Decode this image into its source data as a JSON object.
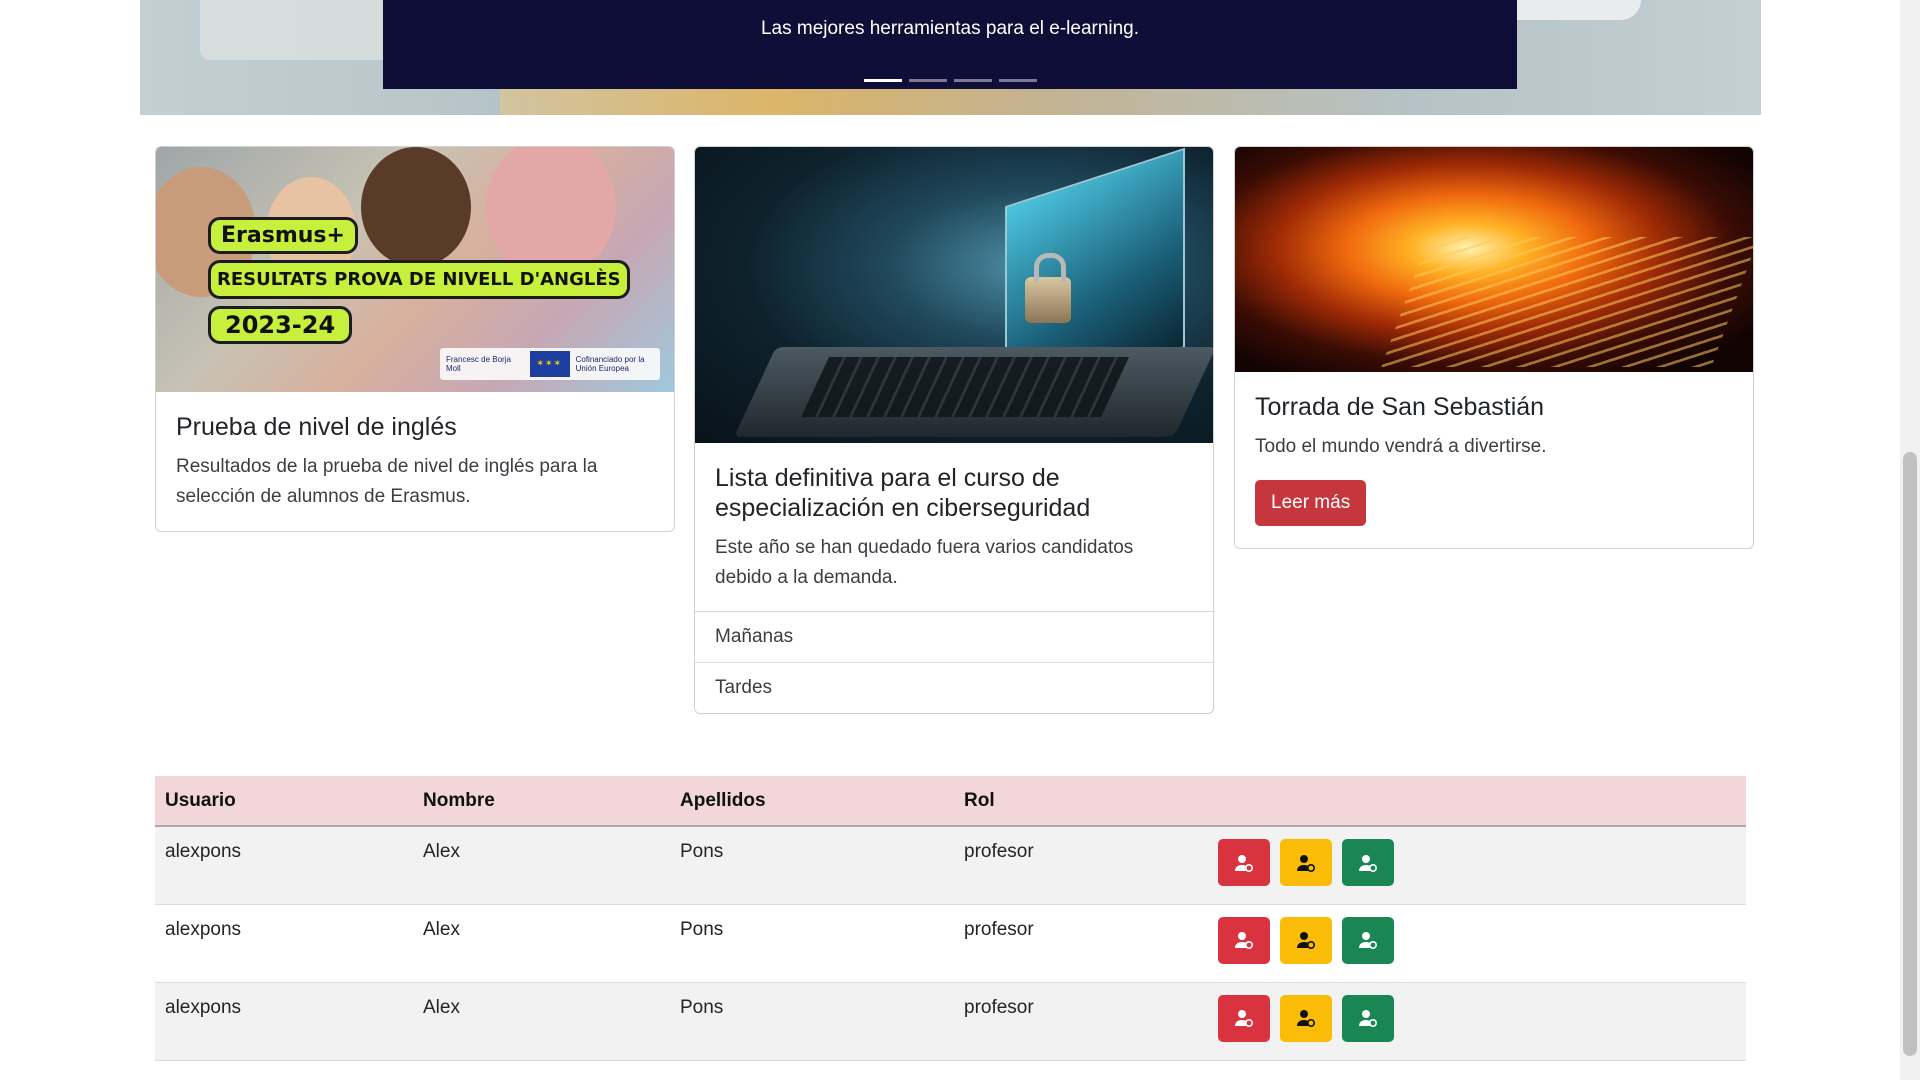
{
  "carousel": {
    "caption": "Las mejores herramientas para el e-learning.",
    "slide_count": 4,
    "active_slide": 1
  },
  "cards": [
    {
      "title": "Prueba de nivel de inglés",
      "text": "Resultados de la prueba de nivel de inglés para la selección de alumnos de Erasmus.",
      "image": {
        "program": "Erasmus+",
        "headline": "RESULTATS PROVA DE NIVELL D'ANGLÈS",
        "year": "2023-24",
        "logo_left": "Francesc de Borja Moll",
        "logo_right": "Cofinanciado por la Unión Europea"
      }
    },
    {
      "title": "Lista definitiva para el curso de especialización en ciberseguridad",
      "text": "Este año se han quedado fuera varios candidatos debido a la demanda.",
      "list": [
        "Mañanas",
        "Tardes"
      ]
    },
    {
      "title": "Torrada de San Sebastián",
      "text": "Todo el mundo vendrá a divertirse.",
      "button": "Leer más",
      "button_color": "#c5363d"
    }
  ],
  "table": {
    "header_bg": "#f2d6d9",
    "columns": [
      "Usuario",
      "Nombre",
      "Apellidos",
      "Rol",
      ""
    ],
    "rows": [
      {
        "usuario": "alexpons",
        "nombre": "Alex",
        "apellidos": "Pons",
        "rol": "profesor"
      },
      {
        "usuario": "alexpons",
        "nombre": "Alex",
        "apellidos": "Pons",
        "rol": "profesor"
      },
      {
        "usuario": "alexpons",
        "nombre": "Alex",
        "apellidos": "Pons",
        "rol": "profesor"
      }
    ],
    "actions": [
      {
        "icon": "user-gear-icon",
        "color": "#d9333f"
      },
      {
        "icon": "user-gear-icon",
        "color": "#fbbc08"
      },
      {
        "icon": "user-gear-icon",
        "color": "#1a8653"
      }
    ]
  },
  "colors": {
    "caption_bg": "#0f0e38",
    "danger": "#d9333f",
    "warning": "#fbbc08",
    "success": "#1a8653"
  }
}
